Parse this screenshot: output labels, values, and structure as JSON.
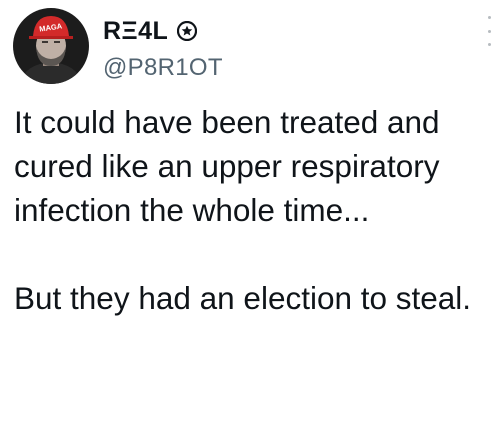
{
  "author": {
    "display_name": "RΞ4L",
    "handle": "@P8R1OT",
    "avatar_cap_text": "MAGA",
    "badge_icon": "star-badge-icon"
  },
  "tweet": {
    "paragraph_1": "It could have been treated and cured like an upper respiratory infection the whole time...",
    "paragraph_2": "But they had an election to steal."
  },
  "menu": {
    "icon": "more-options-icon"
  },
  "colors": {
    "text": "#0f1419",
    "handle": "#536471",
    "cap_red": "#d32a2a"
  }
}
